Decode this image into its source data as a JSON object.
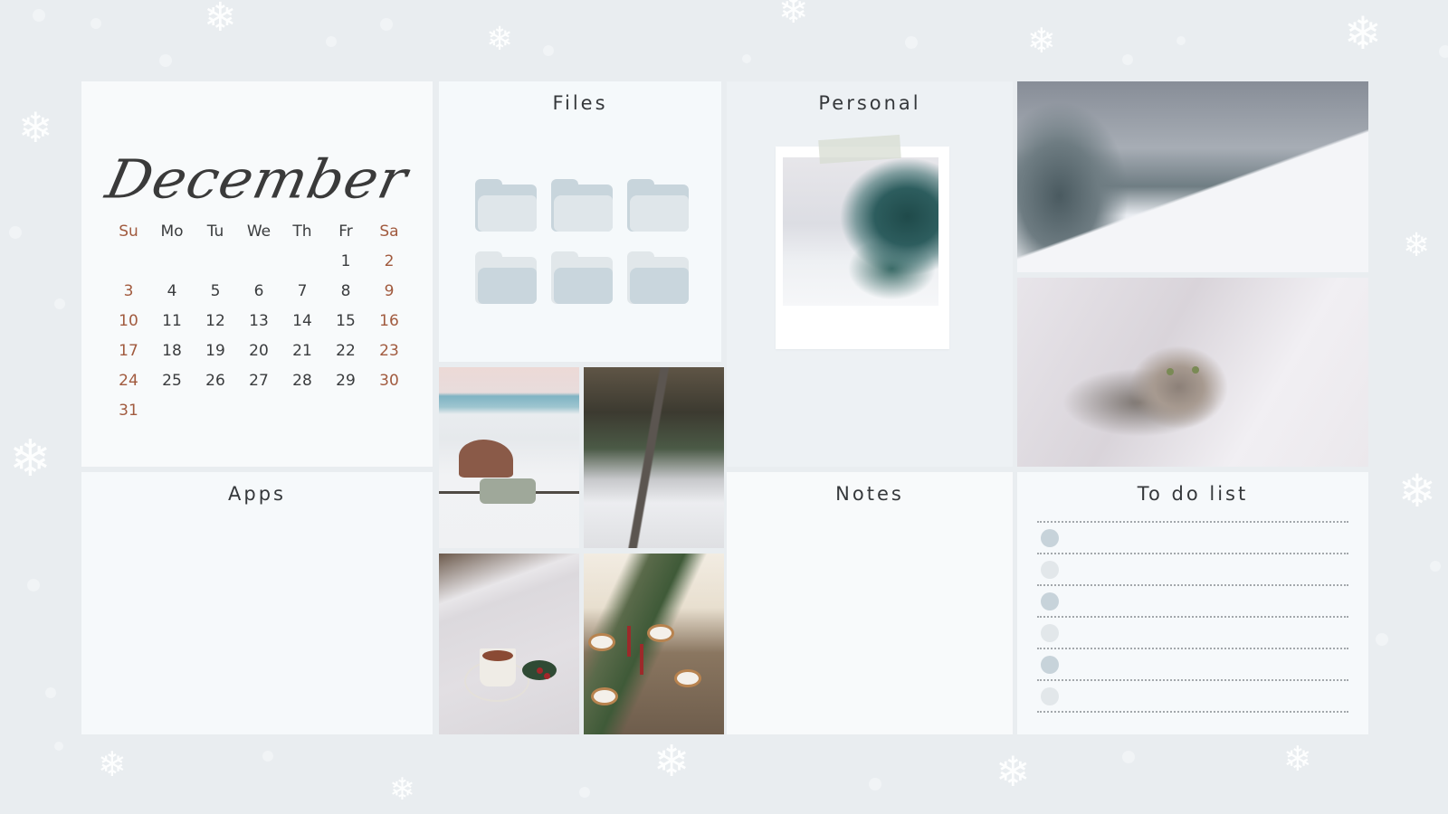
{
  "calendar": {
    "month": "December",
    "weekdays": [
      "Su",
      "Mo",
      "Tu",
      "We",
      "Th",
      "Fr",
      "Sa"
    ],
    "weeks": [
      [
        "",
        "",
        "",
        "",
        "",
        "1",
        "2"
      ],
      [
        "3",
        "4",
        "5",
        "6",
        "7",
        "8",
        "9"
      ],
      [
        "10",
        "11",
        "12",
        "13",
        "14",
        "15",
        "16"
      ],
      [
        "17",
        "18",
        "19",
        "20",
        "21",
        "22",
        "23"
      ],
      [
        "24",
        "25",
        "26",
        "27",
        "28",
        "29",
        "30"
      ],
      [
        "31",
        "",
        "",
        "",
        "",
        "",
        ""
      ]
    ],
    "weekend_color": "#a15a3e"
  },
  "files": {
    "title": "Files",
    "folders": [
      {
        "icon": "folder-icon",
        "style": "light"
      },
      {
        "icon": "folder-icon",
        "style": "light"
      },
      {
        "icon": "folder-icon",
        "style": "light"
      },
      {
        "icon": "folder-icon",
        "style": "dark"
      },
      {
        "icon": "folder-icon",
        "style": "dark"
      },
      {
        "icon": "folder-icon",
        "style": "dark"
      }
    ]
  },
  "personal": {
    "title": "Personal",
    "polaroid_subject": "snowy pine branch"
  },
  "apps": {
    "title": "Apps"
  },
  "notes": {
    "title": "Notes"
  },
  "todo": {
    "title": "To do list",
    "items": [
      {
        "text": "",
        "bullet": "a"
      },
      {
        "text": "",
        "bullet": "b"
      },
      {
        "text": "",
        "bullet": "a"
      },
      {
        "text": "",
        "bullet": "b"
      },
      {
        "text": "",
        "bullet": "a"
      },
      {
        "text": "",
        "bullet": "b"
      }
    ]
  },
  "photos": {
    "forest": "snowy forest hillside",
    "cat": "cat in snow",
    "van": "van by frozen lake",
    "road": "snowy forest road",
    "cocoa": "hot cocoa in snow",
    "table": "festive dinner table"
  },
  "colors": {
    "background": "#e9edf0",
    "panel": "#f6f9fb",
    "accent": "#a15a3e"
  }
}
